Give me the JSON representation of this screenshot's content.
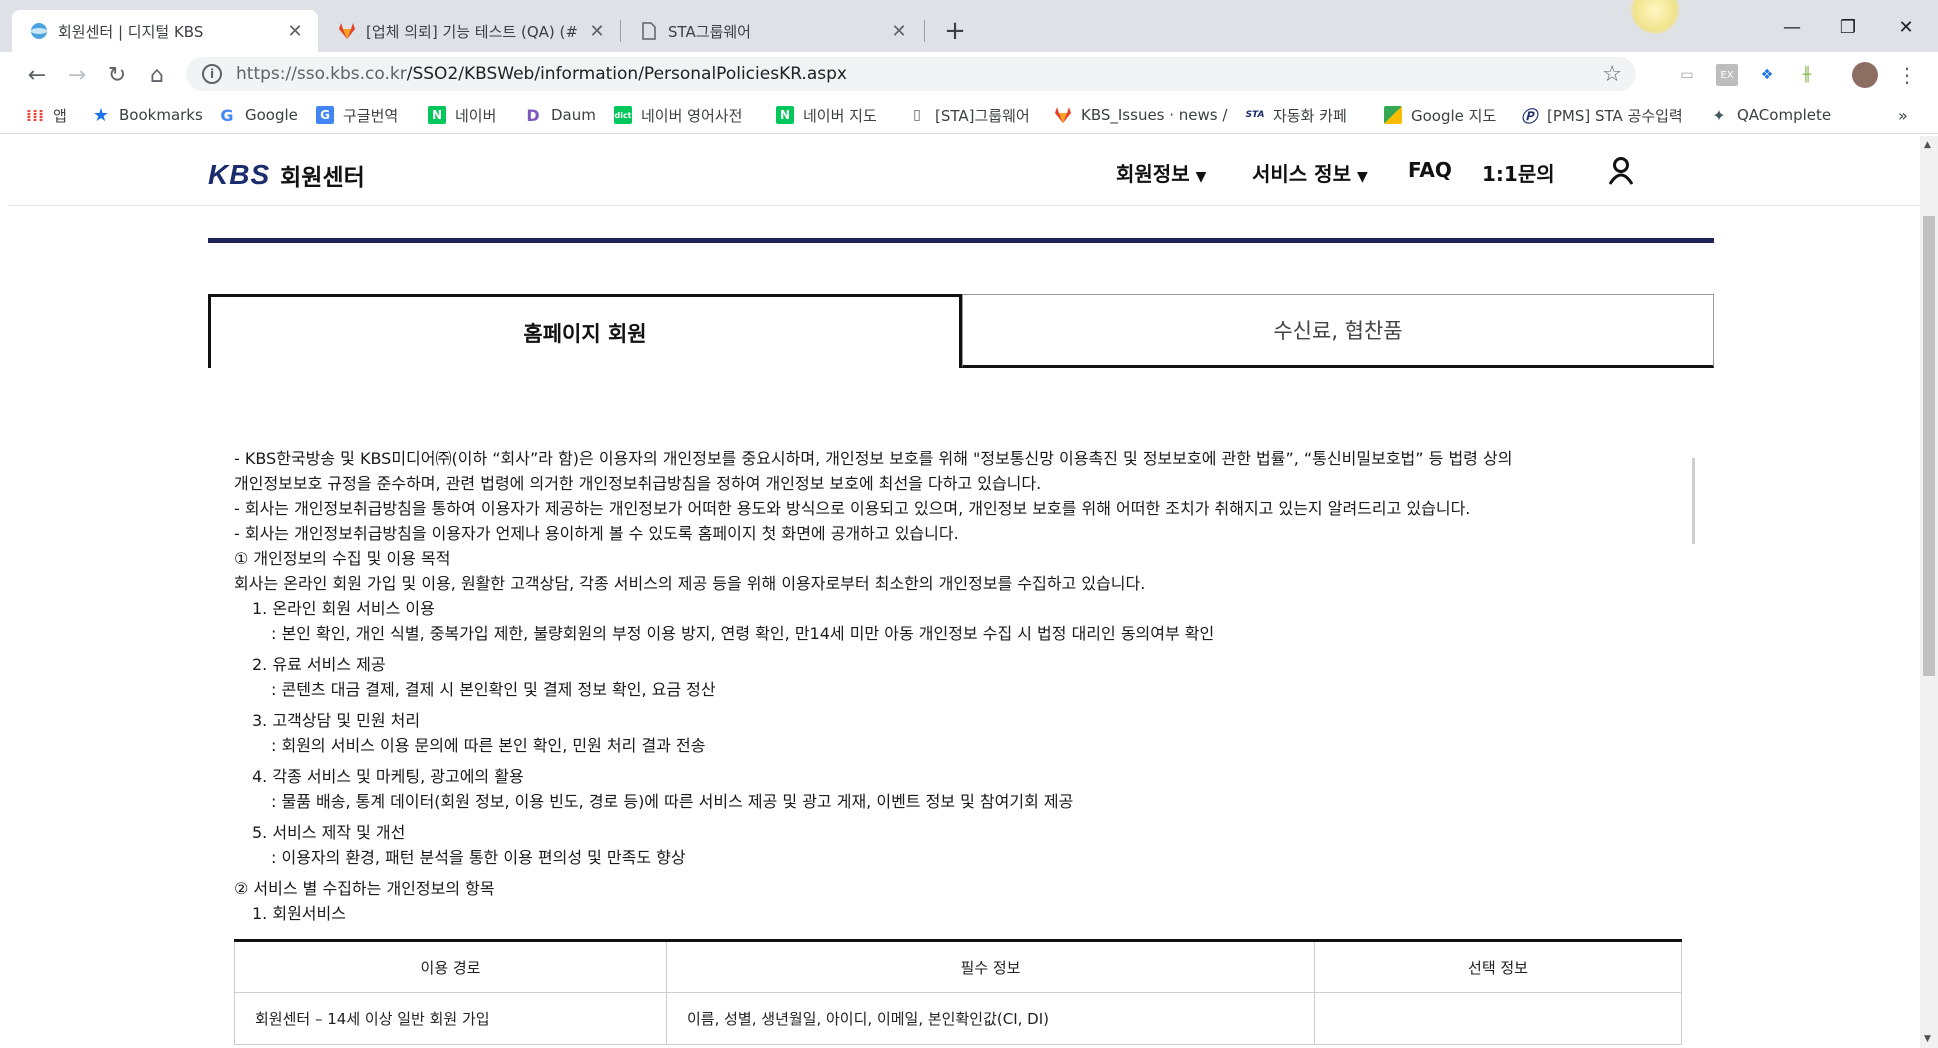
{
  "browser": {
    "tabs": [
      {
        "title": "회원센터 | 디지털 KBS",
        "icon": "kbs-globe-icon"
      },
      {
        "title": "[업체 의뢰] 기능 테스트 (QA) (#",
        "icon": "gitlab-icon"
      },
      {
        "title": "STA그룹웨어",
        "icon": "page-icon"
      }
    ],
    "url_host": "https://sso.kbs.co.kr",
    "url_path": "/SSO2/KBSWeb/information/PersonalPoliciesKR.aspx",
    "bookmarks": [
      {
        "label": "앱",
        "icon": "apps-grid-icon"
      },
      {
        "label": "Bookmarks",
        "icon": "star-icon"
      },
      {
        "label": "Google",
        "icon": "google-icon"
      },
      {
        "label": "구글번역",
        "icon": "google-translate-icon"
      },
      {
        "label": "네이버",
        "icon": "naver-icon"
      },
      {
        "label": "Daum",
        "icon": "daum-icon"
      },
      {
        "label": "네이버 영어사전",
        "icon": "naver-dict-icon"
      },
      {
        "label": "네이버 지도",
        "icon": "naver-icon"
      },
      {
        "label": "[STA]그룹웨어",
        "icon": "page-icon"
      },
      {
        "label": "KBS_Issues · news / ",
        "icon": "gitlab-icon"
      },
      {
        "label": "자동화 카페",
        "icon": "sta-icon"
      },
      {
        "label": "Google 지도",
        "icon": "google-maps-icon"
      },
      {
        "label": "[PMS] STA 공수입력",
        "icon": "pms-icon"
      },
      {
        "label": "QAComplete",
        "icon": "qacomplete-icon"
      }
    ],
    "more_bookmarks": "»"
  },
  "site": {
    "logo_kbs": "KBS",
    "logo_text": "회원센터",
    "nav": {
      "member_info": "회원정보",
      "service_info": "서비스 정보",
      "faq": "FAQ",
      "inquiry": "1:1문의"
    }
  },
  "tabs": {
    "homepage_member": "홈페이지 회원",
    "license_fee": "수신료, 협찬품"
  },
  "content": {
    "l1": "- KBS한국방송 및 KBS미디어㈜(이하 “회사”라 함)은 이용자의 개인정보를 중요시하며, 개인정보 보호를 위해 \"정보통신망 이용촉진 및 정보보호에 관한 법률”, “통신비밀보호법” 등 법령 상의",
    "l2": "개인정보보호 규정을 준수하며, 관련 법령에 의거한 개인정보취급방침을 정하여 개인정보 보호에 최선을 다하고 있습니다.",
    "l3": "- 회사는 개인정보취급방침을 통하여 이용자가 제공하는 개인정보가 어떠한 용도와 방식으로 이용되고 있으며, 개인정보 보호를 위해 어떠한 조치가 취해지고 있는지 알려드리고 있습니다.",
    "l4": "- 회사는 개인정보취급방침을 이용자가 언제나 용이하게 볼 수 있도록 홈페이지 첫 화면에 공개하고 있습니다.",
    "s1_title": "① 개인정보의 수집 및 이용 목적",
    "s1_desc": "회사는 온라인 회원 가입 및 이용, 원활한 고객상담, 각종 서비스의 제공 등을 위해 이용자로부터 최소한의 개인정보를 수집하고 있습니다.",
    "items": [
      {
        "title": "1. 온라인 회원 서비스 이용",
        "desc": ": 본인 확인, 개인 식별, 중복가입 제한, 불량회원의 부정 이용 방지, 연령 확인, 만14세 미만 아동 개인정보 수집 시 법정 대리인 동의여부 확인"
      },
      {
        "title": "2. 유료 서비스 제공",
        "desc": ": 콘텐츠 대금 결제, 결제 시 본인확인 및 결제 정보 확인, 요금 정산"
      },
      {
        "title": "3. 고객상담 및 민원 처리",
        "desc": ": 회원의 서비스 이용 문의에 따른 본인 확인, 민원 처리 결과 전송"
      },
      {
        "title": "4. 각종 서비스 및 마케팅, 광고에의 활용",
        "desc": ": 물품 배송, 통계 데이터(회원 정보, 이용 빈도, 경로 등)에 따른 서비스 제공 및 광고 게재, 이벤트 정보 및 참여기회 제공"
      },
      {
        "title": "5. 서비스 제작 및 개선",
        "desc": ": 이용자의 환경, 패턴 분석을 통한 이용 편의성 및 만족도 향상"
      }
    ],
    "s2_title": "② 서비스 별 수집하는 개인정보의 항목",
    "s2_sub": "1. 회원서비스"
  },
  "table": {
    "headers": [
      "이용 경로",
      "필수 정보",
      "선택 정보"
    ],
    "rows": [
      [
        "회원센터 – 14세 이상 일반 회원 가입",
        "이름, 성별, 생년월일, 아이디, 이메일, 본인확인값(CI, DI)",
        ""
      ]
    ]
  }
}
